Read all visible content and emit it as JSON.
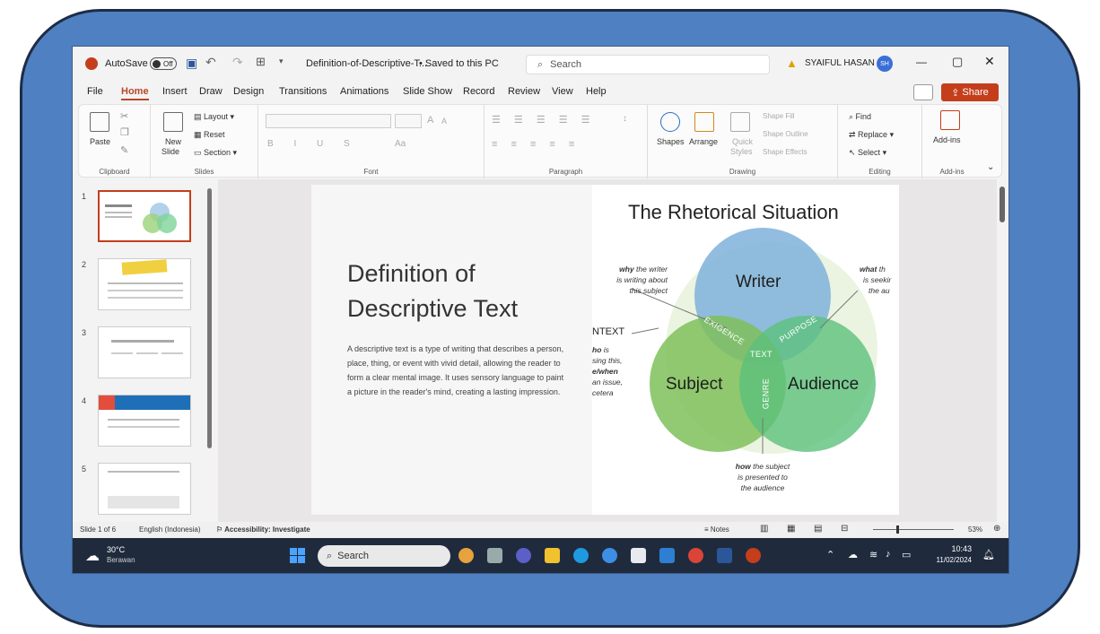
{
  "titlebar": {
    "autosave_label": "AutoSave",
    "autosave_state": "Off",
    "file_name": "Definition-of-Descriptive-T...",
    "save_status": "• Saved to this PC",
    "search_placeholder": "Search",
    "user_name": "SYAIFUL HASAN",
    "user_initials": "SH"
  },
  "menu": {
    "items": [
      "File",
      "Home",
      "Insert",
      "Draw",
      "Design",
      "Transitions",
      "Animations",
      "Slide Show",
      "Record",
      "Review",
      "View",
      "Help"
    ],
    "active": "Home",
    "share_label": "Share"
  },
  "ribbon": {
    "clipboard": {
      "paste": "Paste",
      "label": "Clipboard"
    },
    "slides": {
      "new_slide_1": "New",
      "new_slide_2": "Slide",
      "layout": "Layout",
      "reset": "Reset",
      "section": "Section",
      "label": "Slides"
    },
    "font": {
      "label": "Font",
      "size_up": "A",
      "size_down": "A",
      "case": "Aa"
    },
    "paragraph": {
      "label": "Paragraph"
    },
    "drawing": {
      "shapes": "Shapes",
      "arrange": "Arrange",
      "quick_styles_1": "Quick",
      "quick_styles_2": "Styles",
      "shape_fill": "Shape Fill",
      "shape_outline": "Shape Outline",
      "shape_effects": "Shape Effects",
      "label": "Drawing"
    },
    "editing": {
      "find": "Find",
      "replace": "Replace",
      "select": "Select",
      "label": "Editing"
    },
    "addins": {
      "addins": "Add-ins",
      "label": "Add-ins"
    }
  },
  "thumbnails": {
    "numbers": [
      "1",
      "2",
      "3",
      "4",
      "5"
    ],
    "selected": 1
  },
  "slide": {
    "title_line1": "Definition of",
    "title_line2": "Descriptive Text",
    "body": "A descriptive text is a type of writing that describes a person, place, thing, or event with vivid detail, allowing the reader to form a clear mental image. It uses sensory language to paint a picture in the reader's mind, creating a lasting impression.",
    "diagram": {
      "title": "The Rhetorical Situation",
      "writer": "Writer",
      "subject": "Subject",
      "audience": "Audience",
      "exigence": "EXIGENCE",
      "purpose": "PURPOSE",
      "text": "TEXT",
      "genre": "GENRE",
      "context": "NTEXT",
      "why_1": "why",
      "why_2": " the writer",
      "why_3": "is writing about",
      "why_4": "this subject",
      "what_1": "what",
      "what_2": " th",
      "what_3": "is seekir",
      "what_4": "the au",
      "who_1": "ho",
      "who_2": " is",
      "who_3": "sing this,",
      "who_4": "e/when",
      "who_5": "an issue,",
      "who_6": "cetera",
      "how_1": "how",
      "how_2": " the subject",
      "how_3": "is presented to",
      "how_4": "the audience"
    }
  },
  "status": {
    "slide_count": "Slide 1 of 6",
    "language": "English (Indonesia)",
    "accessibility": "Accessibility: Investigate",
    "notes": "Notes",
    "zoom": "53%"
  },
  "taskbar": {
    "weather_temp": "30°C",
    "weather_desc": "Berawan",
    "search": "Search",
    "time": "10:43",
    "date": "11/02/2024"
  },
  "colors": {
    "accent": "#c43e1c",
    "frame": "#4f80c1",
    "writer": "#7fb1da",
    "subject": "#7fbf5b",
    "audience": "#5cc07c"
  }
}
